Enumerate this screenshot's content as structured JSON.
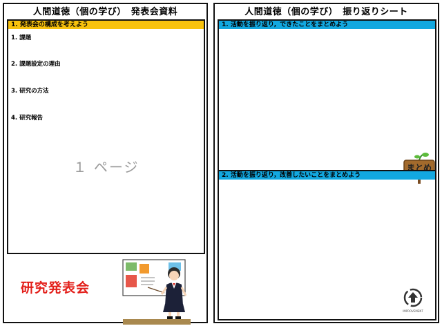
{
  "left": {
    "title": "人間道徳（個の学び）　発表会資料",
    "section_header": "1. 発表会の構成を考えよう",
    "items": [
      "1. 課題",
      "2. 課題設定の理由",
      "3. 研究の方法",
      "4. 研究報告"
    ],
    "page_label": "１ ページ",
    "event_title": "研究発表会"
  },
  "right": {
    "title": "人間道徳（個の学び）　振り返りシート",
    "section1": "1. 活動を振り返り，できたことをまとめよう",
    "section2": "2. 活動を振り返り，改善したいことをまとめよう",
    "sign_text": "まとめ",
    "badge_text": "IMPROVEMENT"
  },
  "colors": {
    "yellow_header": "#f8c20d",
    "blue_header": "#12a8e0",
    "event_title": "#e3201b"
  }
}
